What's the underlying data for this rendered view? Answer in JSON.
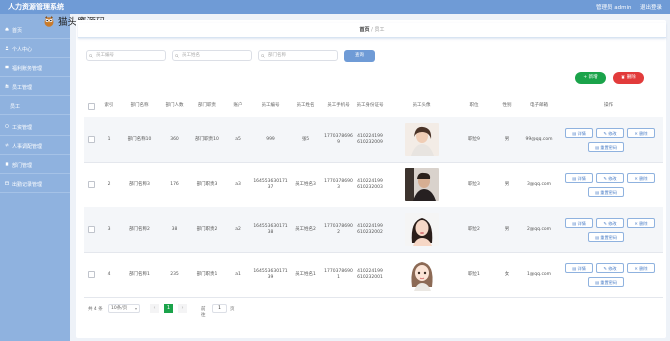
{
  "app": {
    "title": "人力资源管理系统",
    "user": "管理员 admin",
    "logout": "退出登录"
  },
  "watermark": {
    "text": "猫头鹰源码",
    "icon": "owl-logo"
  },
  "sidebar": {
    "items": [
      {
        "label": "首页",
        "icon": "home-icon"
      },
      {
        "label": "个人中心",
        "icon": "user-icon"
      },
      {
        "label": "福利账务管理",
        "icon": "wallet-icon"
      },
      {
        "label": "员工管理",
        "icon": "users-icon"
      },
      {
        "label": "员工",
        "icon": ""
      },
      {
        "label": "工资管理",
        "icon": "money-icon"
      },
      {
        "label": "人事调配管理",
        "icon": "transfer-icon"
      },
      {
        "label": "部门管理",
        "icon": "building-icon"
      },
      {
        "label": "出勤记录管理",
        "icon": "calendar-icon"
      }
    ]
  },
  "breadcrumb": {
    "home": "首页",
    "sep": "/",
    "current": "员工"
  },
  "search": {
    "fields": [
      {
        "placeholder": "员工编号"
      },
      {
        "placeholder": "员工姓名"
      },
      {
        "placeholder": "部门名称"
      }
    ],
    "button": "查询"
  },
  "actions": {
    "add": "+ 新增",
    "delete": "删除"
  },
  "table": {
    "headers": [
      "",
      "索引",
      "部门名称",
      "部门人数",
      "部门职责",
      "账户",
      "员工编号",
      "员工姓名",
      "员工手机号",
      "员工身份证号",
      "员工头像",
      "职位",
      "性别",
      "电子邮箱",
      "操作"
    ],
    "rows": [
      {
        "index": "1",
        "dept_name": "部门名称10",
        "dept_count": "360",
        "dept_duty": "部门职责10",
        "account": "a5",
        "emp_no": "999",
        "emp_name": "张5",
        "phone": "17703786969",
        "id_no": "410224199610232009",
        "position": "职位9",
        "gender": "男",
        "email": "99@qq.com",
        "photo": "portrait-woman-1"
      },
      {
        "index": "2",
        "dept_name": "部门名称3",
        "dept_count": "176",
        "dept_duty": "部门职责3",
        "account": "a3",
        "emp_no": "16455363017137",
        "emp_name": "员工姓名3",
        "phone": "17703786903",
        "id_no": "410224199610232003",
        "position": "职位3",
        "gender": "男",
        "email": "3@qq.com",
        "photo": "portrait-man-1"
      },
      {
        "index": "3",
        "dept_name": "部门名称2",
        "dept_count": "38",
        "dept_duty": "部门职责2",
        "account": "a2",
        "emp_no": "16455363017138",
        "emp_name": "员工姓名2",
        "phone": "17703786902",
        "id_no": "410224199610232002",
        "position": "职位2",
        "gender": "男",
        "email": "2@qq.com",
        "photo": "portrait-woman-2"
      },
      {
        "index": "4",
        "dept_name": "部门名称1",
        "dept_count": "235",
        "dept_duty": "部门职责1",
        "account": "a1",
        "emp_no": "16455363017139",
        "emp_name": "员工姓名1",
        "phone": "17703786901",
        "id_no": "410224199610232001",
        "position": "职位1",
        "gender": "女",
        "email": "1@qq.com",
        "photo": "illustration-girl"
      }
    ],
    "ops": {
      "detail": "详情",
      "edit": "修改",
      "delete": "删除",
      "reset": "重置密码"
    }
  },
  "pager": {
    "total": "共 4 条",
    "size": "10条/页",
    "page": "1",
    "goto_label": "前往",
    "goto_value": "1",
    "goto_unit": "页"
  },
  "colors": {
    "topbar": "#6f9bd6",
    "sidebar": "#8fb2df",
    "add": "#1aa34a",
    "delete": "#e23b3b"
  }
}
